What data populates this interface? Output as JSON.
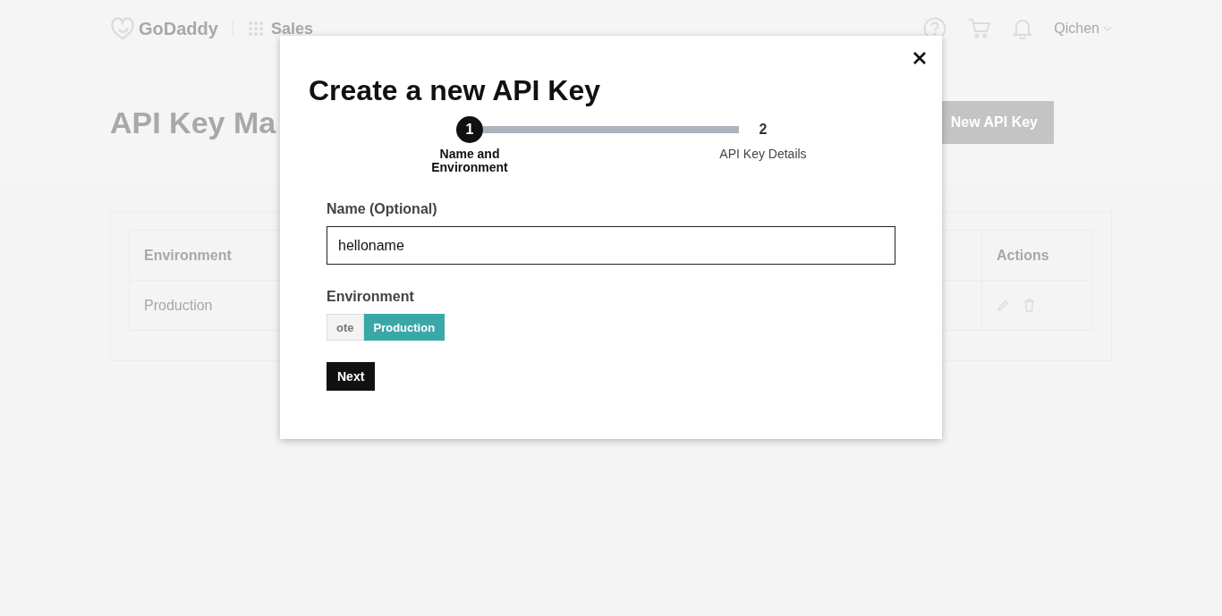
{
  "header": {
    "logo": "GoDaddy",
    "app": "Sales",
    "user": "Qichen"
  },
  "page": {
    "title": "API Key Ma",
    "create_button": "New API Key"
  },
  "table": {
    "columns": [
      "Environment",
      "Actions"
    ],
    "rows": [
      {
        "cells": [
          "Production"
        ]
      }
    ]
  },
  "modal": {
    "title": "Create a new API Key",
    "steps": [
      {
        "number": "1",
        "label": "Name and Environment",
        "selected": true
      },
      {
        "number": "2",
        "label": "API Key Details",
        "selected": false
      }
    ],
    "progress": {
      "level": 1
    },
    "name_label": "Name (Optional)",
    "name_value": "helloname",
    "environment_label": "Environment",
    "environments": [
      {
        "label": "ote",
        "selected": false
      },
      {
        "label": "Production",
        "selected": true
      }
    ],
    "next_button": "Next"
  }
}
